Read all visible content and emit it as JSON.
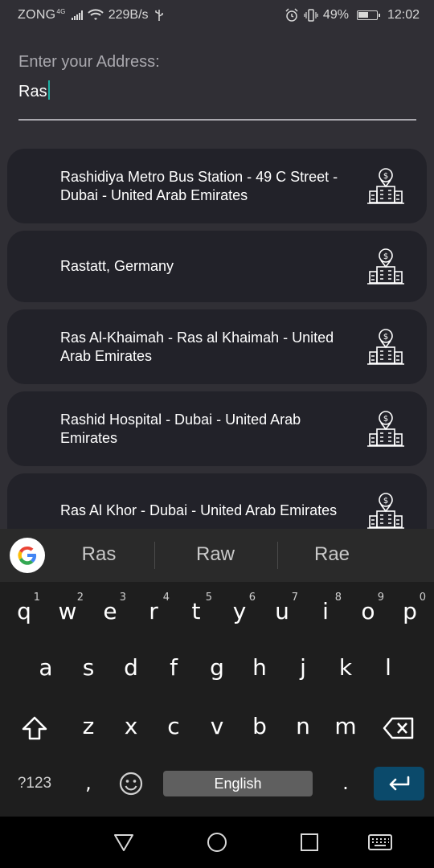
{
  "status_bar": {
    "carrier": "ZONG",
    "network_type": "4G",
    "data_speed": "229B/s",
    "battery_percent": "49%",
    "time": "12:02",
    "icons": [
      "signal-icon",
      "wifi-icon",
      "usb-icon",
      "alarm-icon",
      "vibrate-icon",
      "battery-icon"
    ]
  },
  "address": {
    "label": "Enter your Address:",
    "value": "Ras"
  },
  "suggestions": [
    {
      "text": "Rashidiya Metro Bus Station - 49 C Street - Dubai - United Arab Emirates",
      "icon": "building-location-icon"
    },
    {
      "text": "Rastatt, Germany",
      "icon": "building-location-icon"
    },
    {
      "text": "Ras Al-Khaimah - Ras al Khaimah - United Arab Emirates",
      "icon": "building-location-icon"
    },
    {
      "text": "Rashid Hospital - Dubai - United Arab Emirates",
      "icon": "building-location-icon"
    },
    {
      "text": "Ras Al Khor - Dubai - United Arab Emirates",
      "icon": "building-location-icon"
    }
  ],
  "keyboard": {
    "word_suggestions": [
      "Ras",
      "Raw",
      "Rae"
    ],
    "row1": [
      {
        "key": "q",
        "hint": "1"
      },
      {
        "key": "w",
        "hint": "2"
      },
      {
        "key": "e",
        "hint": "3"
      },
      {
        "key": "r",
        "hint": "4"
      },
      {
        "key": "t",
        "hint": "5"
      },
      {
        "key": "y",
        "hint": "6"
      },
      {
        "key": "u",
        "hint": "7"
      },
      {
        "key": "i",
        "hint": "8"
      },
      {
        "key": "o",
        "hint": "9"
      },
      {
        "key": "p",
        "hint": "0"
      }
    ],
    "row2": [
      "a",
      "s",
      "d",
      "f",
      "g",
      "h",
      "j",
      "k",
      "l"
    ],
    "row3": [
      "z",
      "x",
      "c",
      "v",
      "b",
      "n",
      "m"
    ],
    "symbols_label": "?123",
    "comma": ",",
    "period": ".",
    "space_label": "English",
    "accent_color": "#0b4a6b"
  },
  "nav_bar": {
    "buttons": [
      "back-icon",
      "home-icon",
      "recents-icon",
      "keyboard-switch-icon"
    ]
  }
}
